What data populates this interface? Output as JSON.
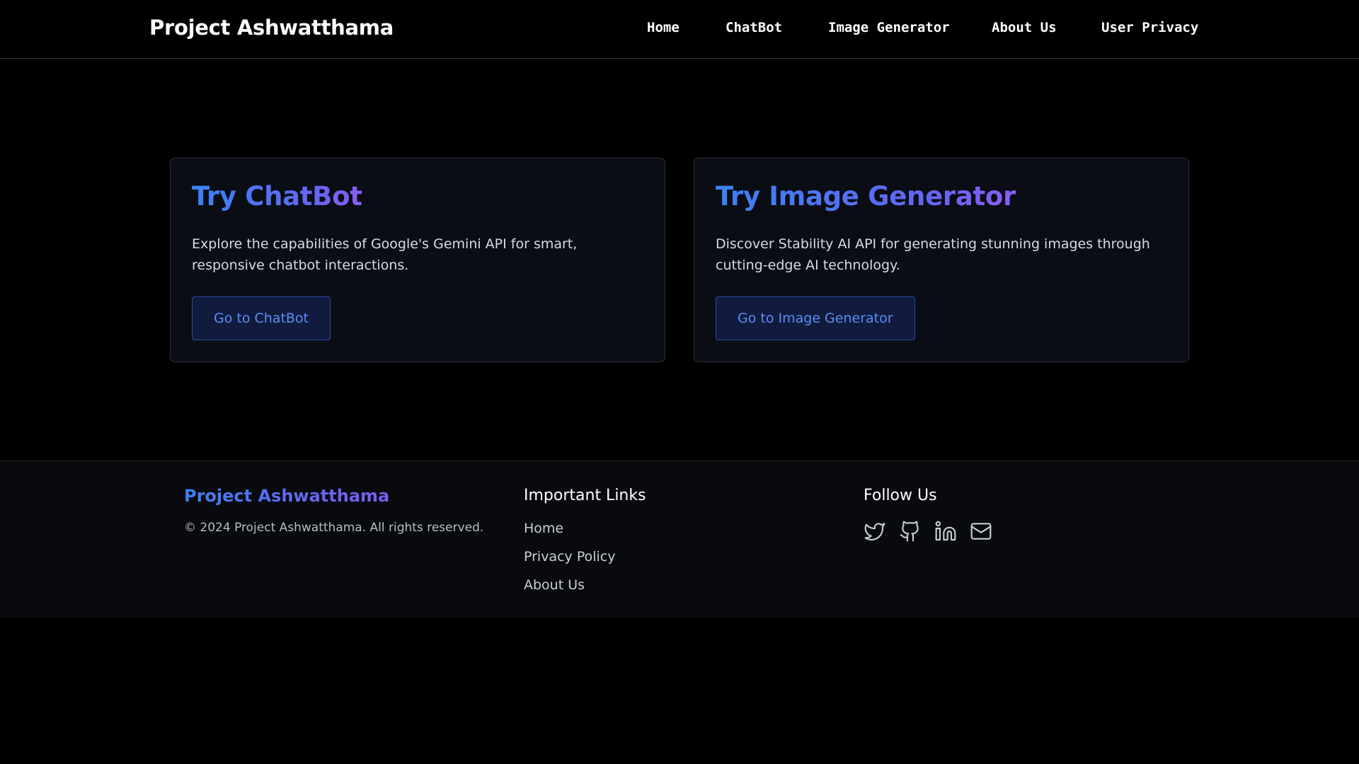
{
  "header": {
    "brand": "Project Ashwatthama",
    "nav": [
      "Home",
      "ChatBot",
      "Image Generator",
      "About Us",
      "User Privacy"
    ]
  },
  "cards": [
    {
      "title": "Try ChatBot",
      "description": "Explore the capabilities of Google's Gemini API for smart, responsive chatbot interactions.",
      "button": "Go to ChatBot"
    },
    {
      "title": "Try Image Generator",
      "description": "Discover Stability AI API for generating stunning images through cutting-edge AI technology.",
      "button": "Go to Image Generator"
    }
  ],
  "footer": {
    "brand": "Project Ashwatthama",
    "copyright": "© 2024 Project Ashwatthama. All rights reserved.",
    "links_title": "Important Links",
    "links": [
      "Home",
      "Privacy Policy",
      "About Us"
    ],
    "follow_title": "Follow Us",
    "socials": [
      "twitter-icon",
      "github-icon",
      "linkedin-icon",
      "mail-icon"
    ]
  },
  "colors": {
    "background": "#000000",
    "accent_blue": "#3b82f6",
    "accent_violet": "#6366f1",
    "card_bg": "#0a0d14",
    "button_bg": "#101b3d",
    "button_text": "#5b8ef5"
  }
}
